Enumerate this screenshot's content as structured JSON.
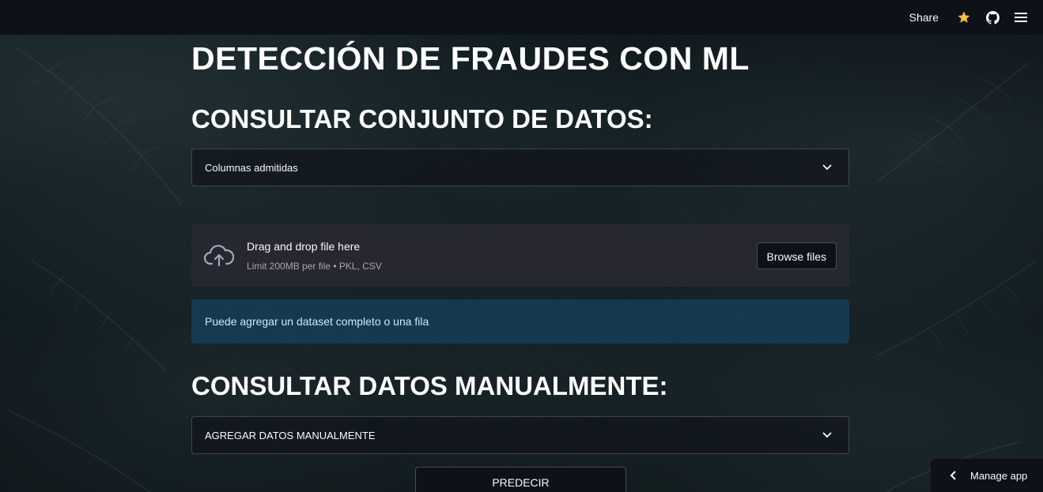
{
  "header": {
    "share_label": "Share",
    "icons": [
      "star-icon",
      "github-icon",
      "hamburger-menu-icon"
    ],
    "star_color": "#ffbd45"
  },
  "main": {
    "title": "DETECCIÓN DE FRAUDES CON ML",
    "section1_title": "CONSULTAR CONJUNTO DE DATOS:",
    "expander1_label": "Columnas admitidas",
    "uploader": {
      "main_text": "Drag and drop file here",
      "sub_text": "Limit 200MB per file • PKL, CSV",
      "browse_label": "Browse files"
    },
    "info_text": "Puede agregar un dataset completo o una fila",
    "section2_title": "CONSULTAR DATOS MANUALMENTE:",
    "expander2_label": "AGREGAR DATOS MANUALMENTE",
    "predict_label": "PREDECIR"
  },
  "footer": {
    "manage_app_label": "Manage app"
  },
  "colors": {
    "header_bg": "#0e1117",
    "uploader_bg": "#262730",
    "info_bg": "#174c73",
    "info_text": "#c7ebff"
  }
}
